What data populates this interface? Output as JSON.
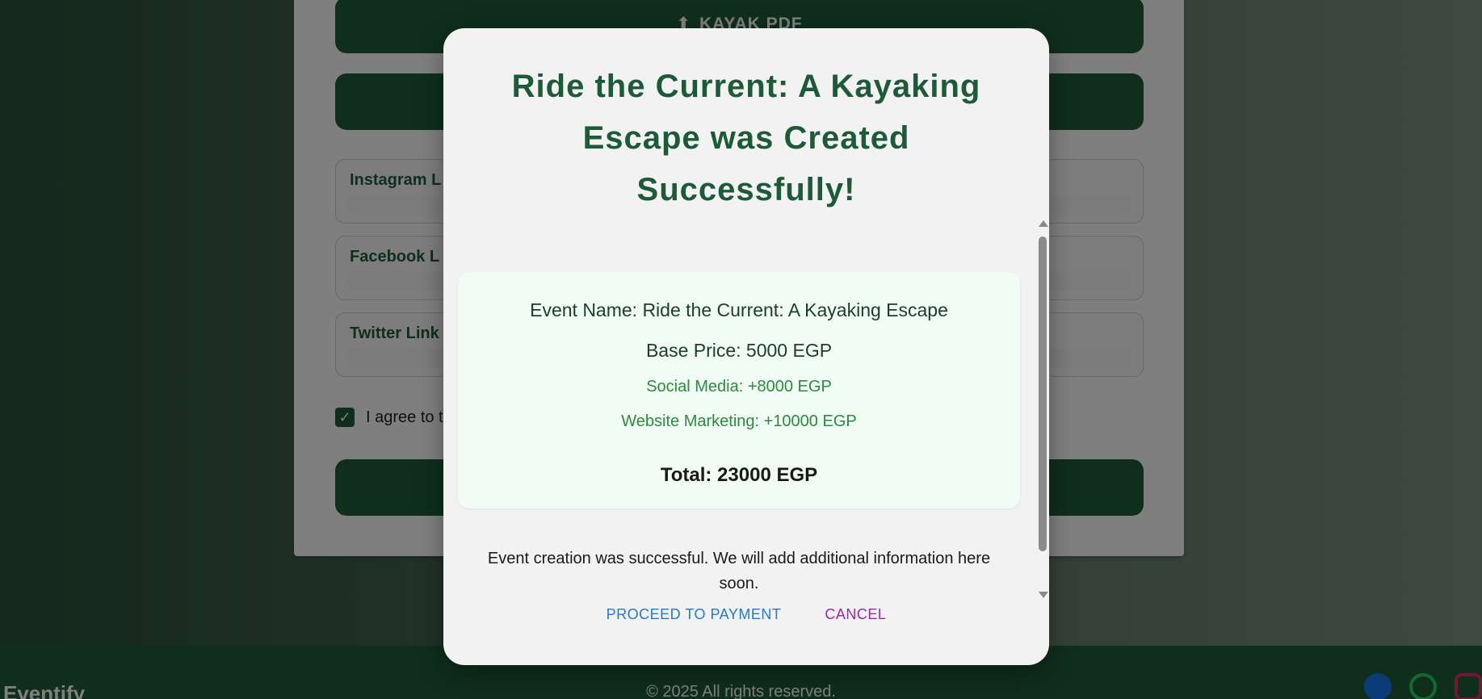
{
  "background": {
    "upload_button_icon": "upload-arrow-icon",
    "upload_button_label": "KAYAK PDF",
    "fields": [
      {
        "label": "Instagram L"
      },
      {
        "label": "Facebook L"
      },
      {
        "label": "Twitter Link"
      }
    ],
    "terms_label": "I agree to t",
    "footer": {
      "brand": "Eventify",
      "copyright": "© 2025 All rights reserved.",
      "social_icons": [
        "facebook-icon",
        "whatsapp-icon",
        "instagram-icon"
      ]
    }
  },
  "modal": {
    "title": "Ride the Current: A Kayaking Escape was Created Successfully!",
    "summary": {
      "event_name": "Event Name: Ride the Current: A Kayaking Escape",
      "base_price": "Base Price: 5000 EGP",
      "addons": [
        "Social Media: +8000 EGP",
        "Website Marketing: +10000 EGP"
      ],
      "total": "Total: 23000 EGP"
    },
    "info": "Event creation was successful. We will add additional information here soon.",
    "actions": {
      "proceed": "PROCEED TO PAYMENT",
      "cancel": "CANCEL"
    }
  },
  "colors": {
    "brand_green": "#1f5c38",
    "title_green": "#1d5a37",
    "addon_green": "#2e8b3e",
    "proceed_blue": "#1e7bd6",
    "cancel_purple": "#9c27b0"
  }
}
